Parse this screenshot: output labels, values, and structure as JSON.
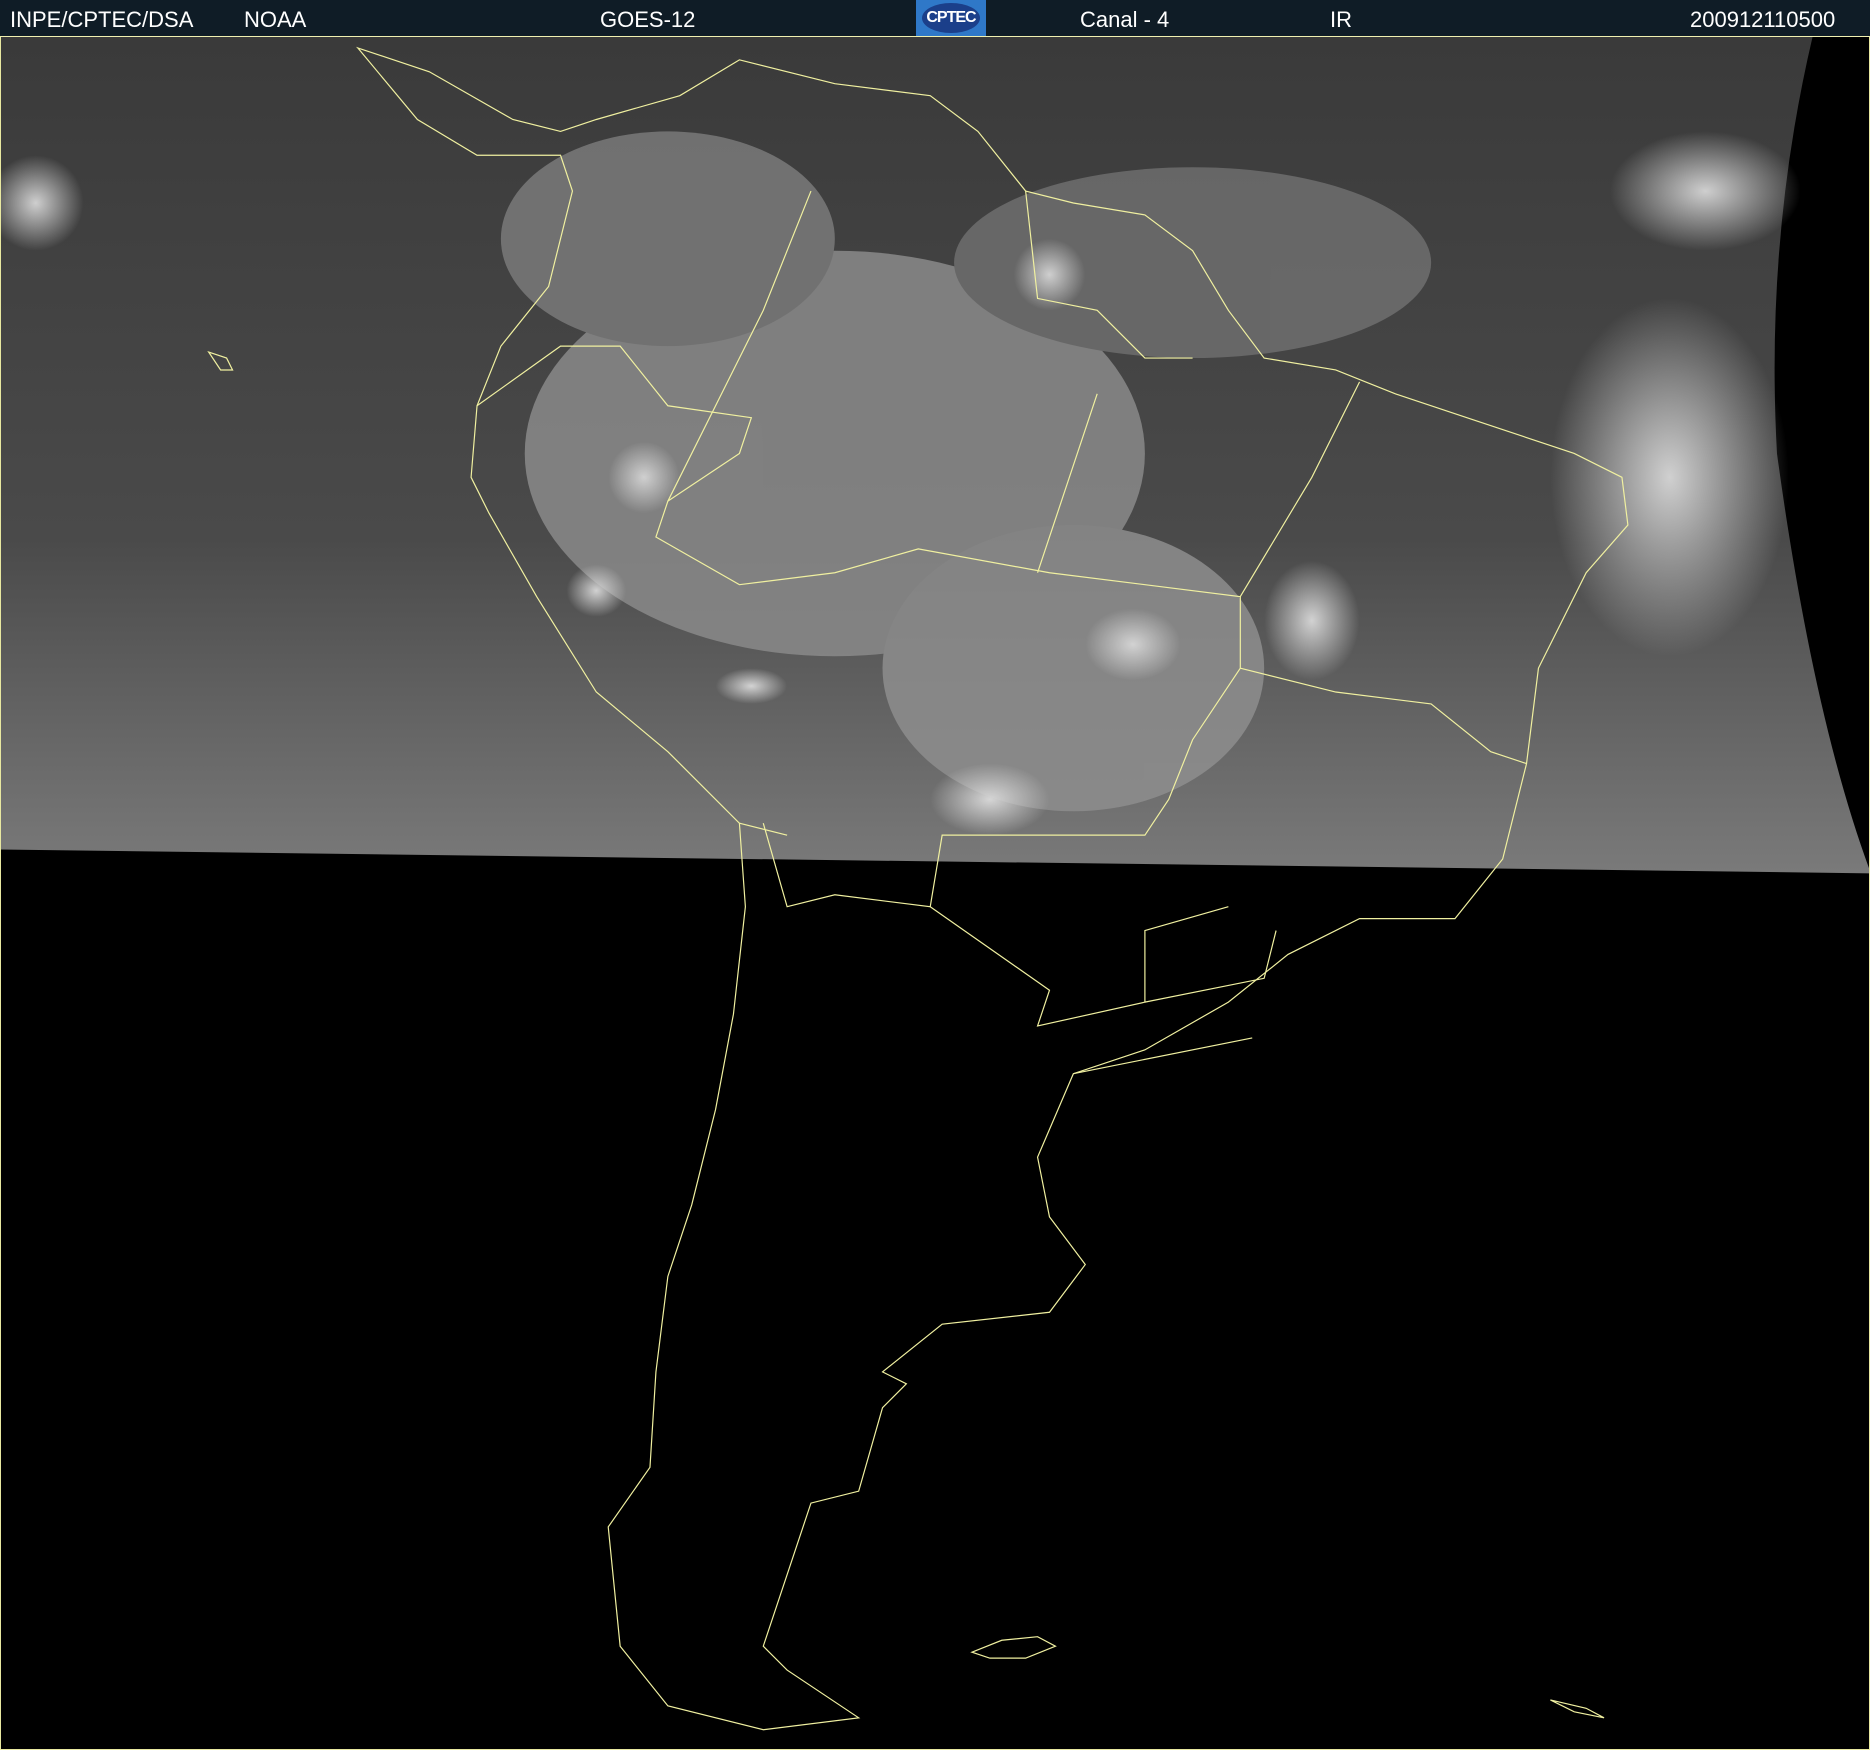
{
  "header": {
    "source": "INPE/CPTEC/DSA",
    "agency": "NOAA",
    "satellite": "GOES-12",
    "logo_text": "CPTEC",
    "channel": "Canal - 4",
    "band": "IR",
    "timestamp": "200912110500"
  },
  "colors": {
    "header_bg": "#0f1c26",
    "coastline": "#f0f0a0",
    "logo_bg": "#2f78c8"
  }
}
